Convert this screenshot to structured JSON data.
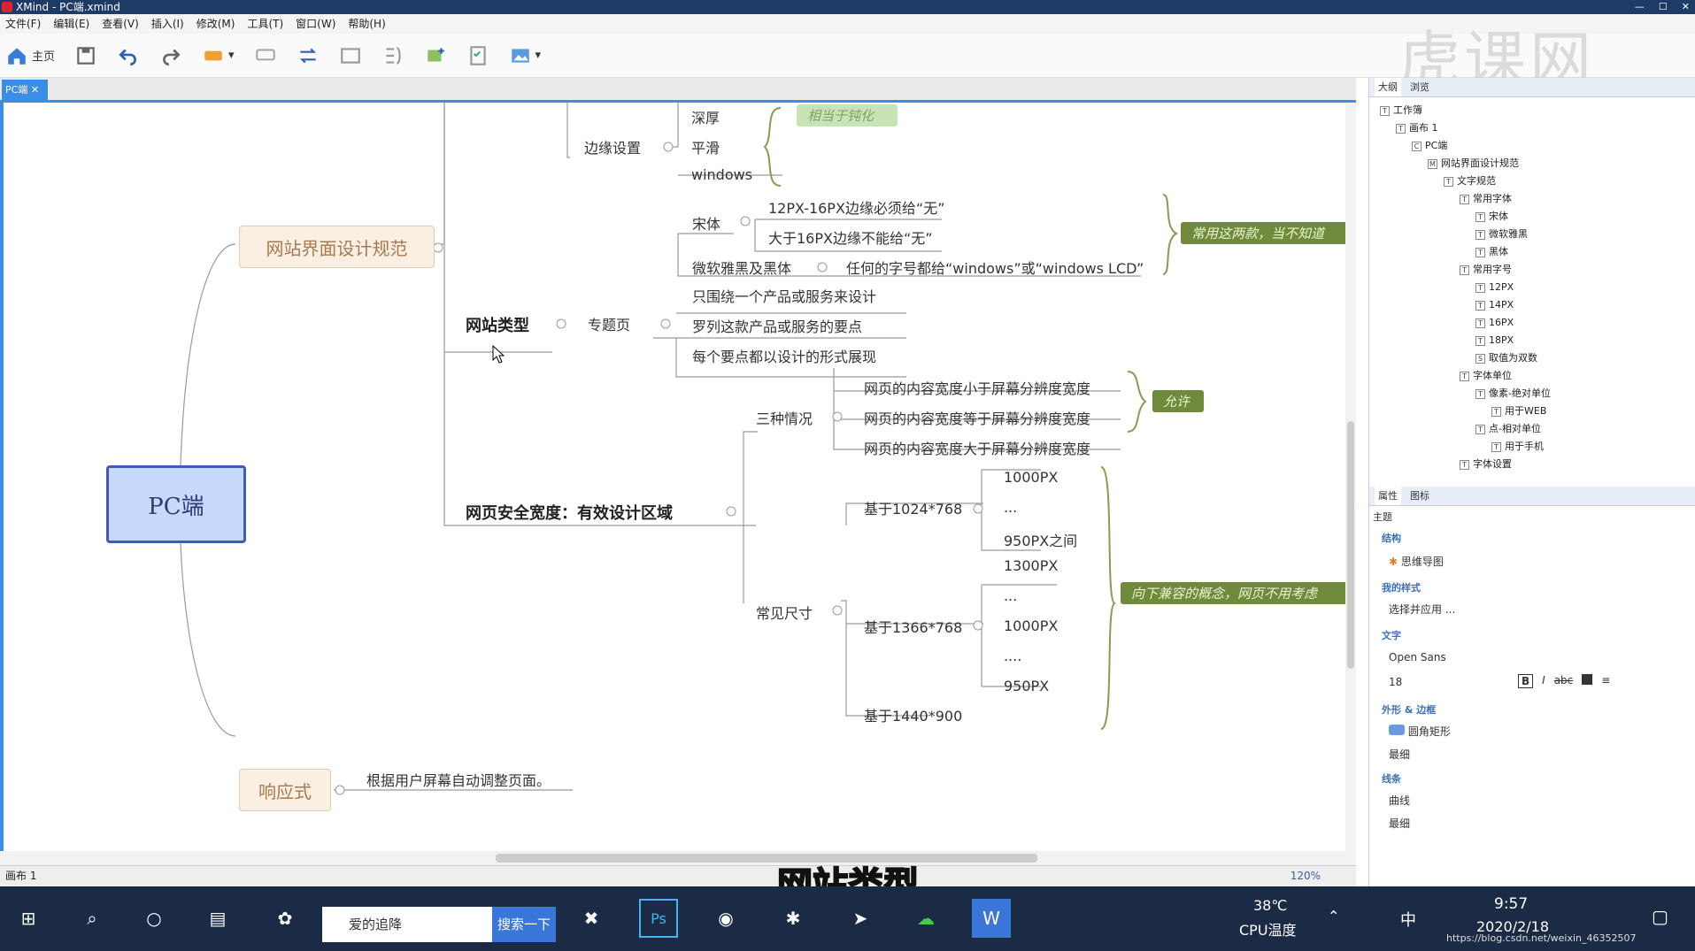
{
  "window": {
    "title": "XMind - PC端.xmind"
  },
  "menu": [
    "文件(F)",
    "编辑(E)",
    "查看(V)",
    "插入(I)",
    "修改(M)",
    "工具(T)",
    "窗口(W)",
    "帮助(H)"
  ],
  "toolbar": {
    "home_label": "主页"
  },
  "watermark": "虎课网",
  "tab": {
    "label": "PC端"
  },
  "map": {
    "root": "PC端",
    "main1": "网站界面设计规范",
    "main2": "响应式",
    "edge": {
      "label": "边缘设置",
      "items": [
        "深厚",
        "平滑",
        "windows"
      ],
      "note": "相当于钝化"
    },
    "font": {
      "song": "宋体",
      "song_items": [
        "12PX-16PX边缘必须给“无”",
        "大于16PX边缘不能给“无”"
      ],
      "yahei": "微软雅黑及黑体",
      "yahei_item": "任何的字号都给“windows”或“windows LCD”",
      "note": "常用这两款，当不知道"
    },
    "type": {
      "label": "网站类型",
      "sub": "专题页",
      "items": [
        "只围绕一个产品或服务来设计",
        "罗列这款产品或服务的要点",
        "每个要点都以设计的形式展现"
      ]
    },
    "safe": {
      "label": "网页安全宽度：有效设计区域",
      "three": "三种情况",
      "three_items": [
        "网页的内容宽度小于屏幕分辨度宽度",
        "网页的内容宽度等于屏幕分辨度宽度",
        "网页的内容宽度大于屏幕分辨度宽度"
      ],
      "three_note": "允许",
      "sizes": "常见尺寸",
      "s1024": "基于1024*768",
      "s1024_items": [
        "1000PX",
        "...",
        "950PX之间"
      ],
      "s1366": "基于1366*768",
      "s1366_items": [
        "1300PX",
        "...",
        "1000PX",
        "....",
        "950PX"
      ],
      "s1440": "基于1440*900",
      "sizes_note": "向下兼容的概念，网页不用考虑"
    },
    "resp_item": "根据用户屏幕自动调整页面。"
  },
  "status": {
    "sheet": "画布 1",
    "zoom": "120%"
  },
  "outline": {
    "tabs": [
      "大纲",
      "浏览"
    ],
    "rows": [
      {
        "level": 0,
        "icon": "T",
        "label": "工作簿"
      },
      {
        "level": 1,
        "icon": "T",
        "label": "画布 1"
      },
      {
        "level": 2,
        "icon": "C",
        "label": "PC端"
      },
      {
        "level": 3,
        "icon": "M",
        "label": "网站界面设计规范"
      },
      {
        "level": 4,
        "icon": "T",
        "label": "文字规范"
      },
      {
        "level": 5,
        "icon": "T",
        "label": "常用字体"
      },
      {
        "level": 6,
        "icon": "T",
        "label": "宋体"
      },
      {
        "level": 6,
        "icon": "T",
        "label": "微软雅黑"
      },
      {
        "level": 6,
        "icon": "T",
        "label": "黑体"
      },
      {
        "level": 5,
        "icon": "T",
        "label": "常用字号"
      },
      {
        "level": 6,
        "icon": "T",
        "label": "12PX"
      },
      {
        "level": 6,
        "icon": "T",
        "label": "14PX"
      },
      {
        "level": 6,
        "icon": "T",
        "label": "16PX"
      },
      {
        "level": 6,
        "icon": "T",
        "label": "18PX"
      },
      {
        "level": 6,
        "icon": "S",
        "label": "取值为双数"
      },
      {
        "level": 5,
        "icon": "T",
        "label": "字体单位"
      },
      {
        "level": 6,
        "icon": "T",
        "label": "像素-绝对单位"
      },
      {
        "level": 7,
        "icon": "T",
        "label": "用于WEB"
      },
      {
        "level": 6,
        "icon": "T",
        "label": "点-相对单位"
      },
      {
        "level": 7,
        "icon": "T",
        "label": "用于手机"
      },
      {
        "level": 5,
        "icon": "T",
        "label": "字体设置"
      }
    ]
  },
  "props": {
    "tabs": [
      "属性",
      "图标"
    ],
    "theme": "主题",
    "structure_label": "结构",
    "structure_value": "思维导图",
    "style_label": "我的样式",
    "style_value": "选择并应用 ...",
    "text_label": "文字",
    "font_value": "Open Sans",
    "size_value": "18",
    "shape_label": "外形 & 边框",
    "shape_value": "圆角矩形",
    "border_value": "最细",
    "line_label": "线条",
    "line_value": "曲线",
    "line_width": "最细"
  },
  "subtitle": "网站类型",
  "taskbar": {
    "search_text": "爱的追降",
    "search_button": "搜索一下",
    "temp": "38℃",
    "temp_label": "CPU温度",
    "ime": "中",
    "time": "9:57",
    "date": "2020/2/18",
    "blog": "https://blog.csdn.net/weixin_46352507"
  }
}
